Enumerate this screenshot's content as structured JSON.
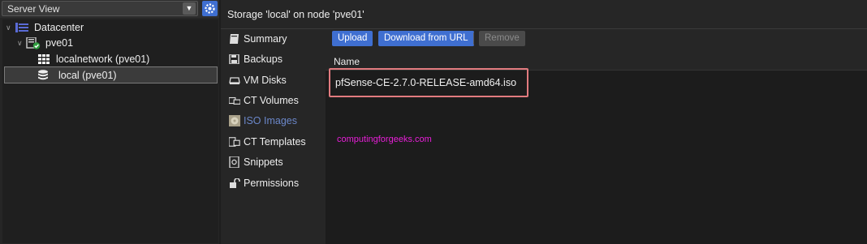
{
  "view_selector": {
    "label": "Server View"
  },
  "tree": {
    "datacenter": "Datacenter",
    "node": "pve01",
    "network": "localnetwork (pve01)",
    "storage": "local (pve01)"
  },
  "header": {
    "title": "Storage 'local' on node 'pve01'"
  },
  "nav": {
    "items": [
      {
        "label": "Summary",
        "icon": "book-icon"
      },
      {
        "label": "Backups",
        "icon": "floppy-icon"
      },
      {
        "label": "VM Disks",
        "icon": "disk-icon"
      },
      {
        "label": "CT Volumes",
        "icon": "ct-disk-icon"
      },
      {
        "label": "ISO Images",
        "icon": "iso-icon"
      },
      {
        "label": "CT Templates",
        "icon": "template-icon"
      },
      {
        "label": "Snippets",
        "icon": "snippet-icon"
      },
      {
        "label": "Permissions",
        "icon": "unlock-icon"
      }
    ],
    "active": "ISO Images"
  },
  "toolbar": {
    "upload": "Upload",
    "download": "Download from URL",
    "remove": "Remove"
  },
  "table": {
    "columns": [
      "Name"
    ],
    "rows": [
      {
        "name": "pfSense-CE-2.7.0-RELEASE-amd64.iso"
      }
    ]
  },
  "watermark": "computingforgeeks.com",
  "colors": {
    "accent": "#3f6fd1",
    "highlight_box": "#e27b7f",
    "watermark": "#e81ed8"
  }
}
